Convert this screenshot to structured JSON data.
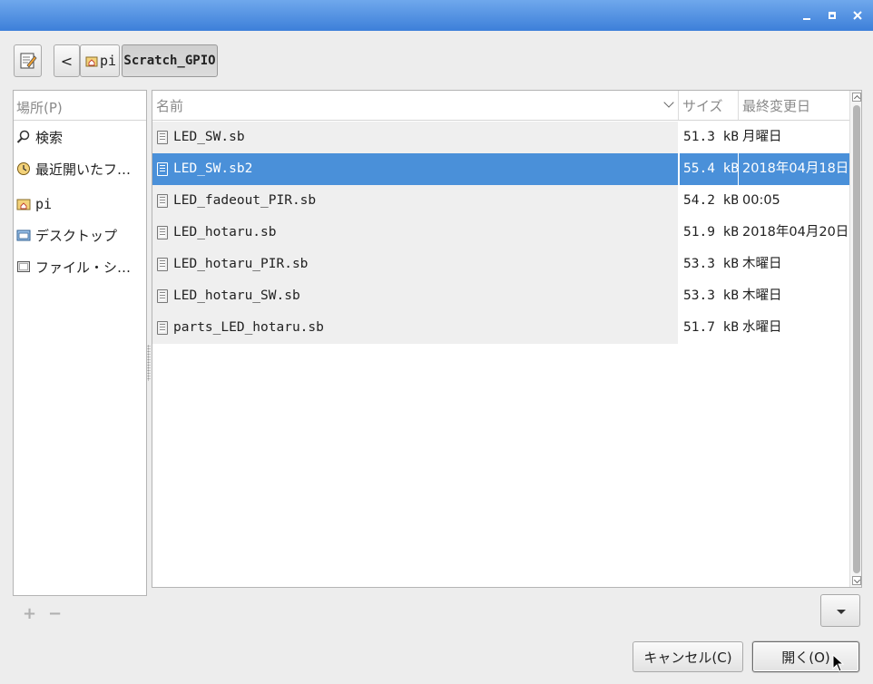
{
  "toolbar": {
    "back_label": "<",
    "crumbs": [
      "pi",
      "Scratch_GPIO"
    ]
  },
  "places": {
    "header": "場所(P)",
    "items": [
      "検索",
      "最近開いたフ…",
      "pi",
      "デスクトップ",
      "ファイル・シ…"
    ]
  },
  "files": {
    "columns": {
      "name": "名前",
      "size": "サイズ",
      "date": "最終変更日"
    },
    "rows": [
      {
        "name": "LED_SW.sb",
        "size": "51.3 kB",
        "date": "月曜日"
      },
      {
        "name": "LED_SW.sb2",
        "size": "55.4 kB",
        "date": "2018年04月18日"
      },
      {
        "name": "LED_fadeout_PIR.sb",
        "size": "54.2 kB",
        "date": "00:05"
      },
      {
        "name": "LED_hotaru.sb",
        "size": "51.9 kB",
        "date": "2018年04月20日"
      },
      {
        "name": "LED_hotaru_PIR.sb",
        "size": "53.3 kB",
        "date": "木曜日"
      },
      {
        "name": "LED_hotaru_SW.sb",
        "size": "53.3 kB",
        "date": "木曜日"
      },
      {
        "name": "parts_LED_hotaru.sb",
        "size": "51.7 kB",
        "date": "水曜日"
      }
    ],
    "selected_index": 1
  },
  "bottom": {
    "add_label": "+",
    "remove_label": "−"
  },
  "actions": {
    "cancel_label": "キャンセル(C)",
    "open_label": "開く(O)"
  },
  "colors": {
    "titlebar": "#3d7fd9",
    "selection": "#4a90d9"
  },
  "icons": [
    "edit-location-icon",
    "home-folder-icon",
    "search-icon",
    "recent-icon",
    "desktop-folder-icon",
    "filesystem-icon",
    "text-file-icon",
    "dropdown-arrow-icon"
  ]
}
